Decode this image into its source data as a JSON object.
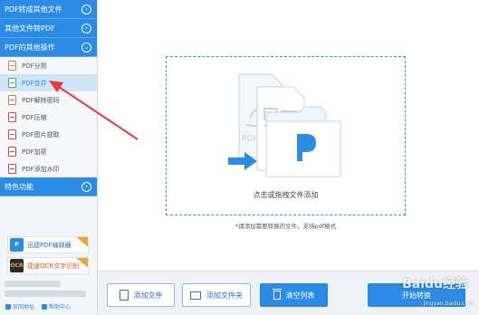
{
  "sidebar": {
    "categories": {
      "pdf_to_other": "PDF转成其他文件",
      "other_to_pdf": "其他文件转PDF",
      "pdf_other_ops": "PDF的其他操作",
      "special": "特色功能"
    },
    "items": [
      {
        "label": "PDF分割"
      },
      {
        "label": "PDF合并"
      },
      {
        "label": "PDF解除密码"
      },
      {
        "label": "PDF压缩"
      },
      {
        "label": "PDF图片提取"
      },
      {
        "label": "PDF加密"
      },
      {
        "label": "PDF添加水印"
      }
    ],
    "promos": {
      "editor": "迅捷PDF编辑器",
      "ocr": "捷速OCR文字识别"
    },
    "links": {
      "website": "官网地址",
      "help": "帮助中心"
    }
  },
  "main": {
    "drop_text": "点击或拖拽文件添加",
    "hint": "*请添加需要转换的文件，支持pdf格式"
  },
  "toolbar": {
    "add_file": "添加文件",
    "add_folder": "添加文件夹",
    "clear_list": "清空列表",
    "start": "开始转换"
  },
  "watermark": {
    "brand": "Baidu经验",
    "url": "jingyan.baidu.com"
  },
  "colors": {
    "accent": "#2c8be4",
    "sidebar_bg": "#f2f5f9",
    "active_item": "#cfe4f7",
    "arrow": "#e33b3b"
  }
}
